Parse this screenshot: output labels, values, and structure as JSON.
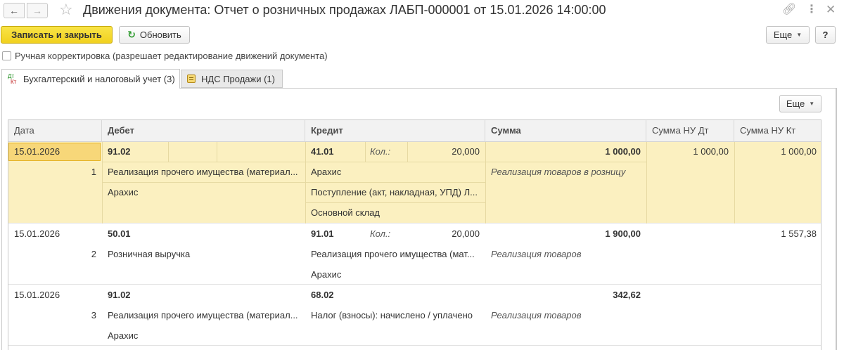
{
  "window": {
    "title": "Движения документа: Отчет о розничных продажах ЛАБП-000001 от 15.01.2026 14:00:00",
    "icons": [
      "back-arrow-icon",
      "forward-arrow-icon",
      "star-icon",
      "link-icon",
      "more-icon",
      "close-icon"
    ]
  },
  "toolbar": {
    "save_close_label": "Записать и закрыть",
    "refresh_label": "Обновить",
    "more_label": "Еще",
    "help_label": "?"
  },
  "manual": {
    "label": "Ручная корректировка (разрешает редактирование движений документа)",
    "checked": false
  },
  "tabs": [
    {
      "label": "Бухгалтерский и налоговый учет (3)",
      "icon_top": "Дт",
      "icon_bottom": "Кт",
      "active": true
    },
    {
      "label": "НДС Продажи (1)",
      "active": false
    }
  ],
  "table": {
    "more_label": "Еще",
    "columns": [
      "Дата",
      "Дебет",
      "Кредит",
      "Сумма",
      "Сумма НУ Дт",
      "Сумма НУ Кт"
    ],
    "rows": [
      {
        "date": "15.01.2026",
        "num": "1",
        "debit_account": "91.02",
        "debit_sub1": "Реализация прочего имущества (материал...",
        "debit_sub2": "Арахис",
        "credit_account": "41.01",
        "qty_label": "Кол.:",
        "qty": "20,000",
        "credit_sub1": "Арахис",
        "credit_sub2": "Поступление (акт, накладная, УПД) Л...",
        "credit_sub3": "Основной склад",
        "amount": "1 000,00",
        "content": "Реализация товаров в розницу",
        "nu_dt": "1 000,00",
        "nu_kt": "1 000,00"
      },
      {
        "date": "15.01.2026",
        "num": "2",
        "debit_account": "50.01",
        "debit_sub1": "Розничная выручка",
        "credit_account": "91.01",
        "qty_label": "Кол.:",
        "qty": "20,000",
        "credit_sub1": "Реализация прочего имущества (мат...",
        "credit_sub2": "Арахис",
        "amount": "1 900,00",
        "content": "Реализация товаров",
        "nu_dt": "",
        "nu_kt": "1 557,38"
      },
      {
        "date": "15.01.2026",
        "num": "3",
        "debit_account": "91.02",
        "debit_sub1": "Реализация прочего имущества (материал...",
        "debit_sub2": "Арахис",
        "credit_account": "68.02",
        "credit_sub1": "Налог (взносы): начислено / уплачено",
        "amount": "342,62",
        "content": "Реализация товаров",
        "nu_dt": "",
        "nu_kt": ""
      }
    ]
  },
  "colors": {
    "primary_button": "#f1d11f",
    "selected_row": "#fbf0c0",
    "focus_cell": "#f7d779",
    "refresh_icon": "#2e9a2e"
  }
}
